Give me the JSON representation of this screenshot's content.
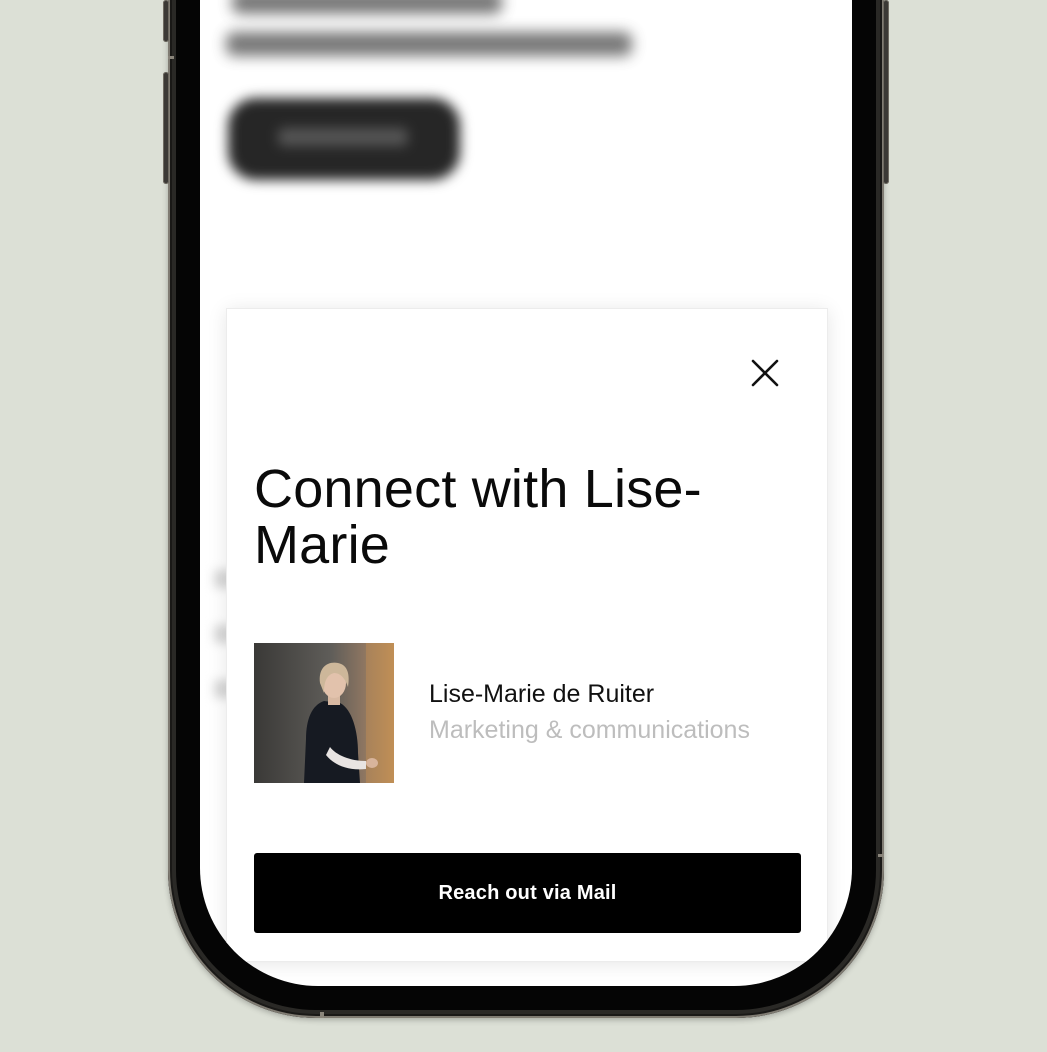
{
  "modal": {
    "title": "Connect with Lise-Marie",
    "contact": {
      "name": "Lise-Marie de Ruiter",
      "role": "Marketing & communications"
    },
    "cta_label": "Reach out via Mail"
  },
  "icons": {
    "close": "close-icon",
    "avatar": "profile-photo"
  },
  "colors": {
    "page_background": "#dce0d6",
    "button_background": "#000000",
    "button_text": "#ffffff",
    "title_text": "#0a0a0a",
    "role_text": "#bdbdbd"
  }
}
